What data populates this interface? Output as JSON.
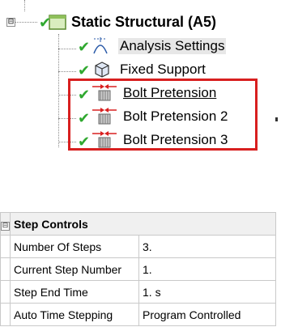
{
  "tree": {
    "root": {
      "label": "Static Structural (A5)",
      "expander": "⊟"
    },
    "children": [
      {
        "label": "Analysis Settings",
        "icon": "analysis-settings-icon",
        "selected": true
      },
      {
        "label": "Fixed Support",
        "icon": "fixed-support-icon"
      },
      {
        "label": "Bolt Pretension",
        "icon": "bolt-pretension-icon"
      },
      {
        "label": "Bolt Pretension 2",
        "icon": "bolt-pretension-icon"
      },
      {
        "label": "Bolt Pretension 3",
        "icon": "bolt-pretension-icon"
      }
    ],
    "highlight_color": "#d81f1f",
    "check_color": "#2fa82f"
  },
  "details": {
    "group": {
      "expander": "⊟",
      "title": "Step Controls"
    },
    "rows": [
      {
        "name": "Number Of Steps",
        "value": "3."
      },
      {
        "name": "Current Step Number",
        "value": "1."
      },
      {
        "name": "Step End Time",
        "value": "1. s"
      },
      {
        "name": "Auto Time Stepping",
        "value": "Program Controlled"
      }
    ]
  }
}
